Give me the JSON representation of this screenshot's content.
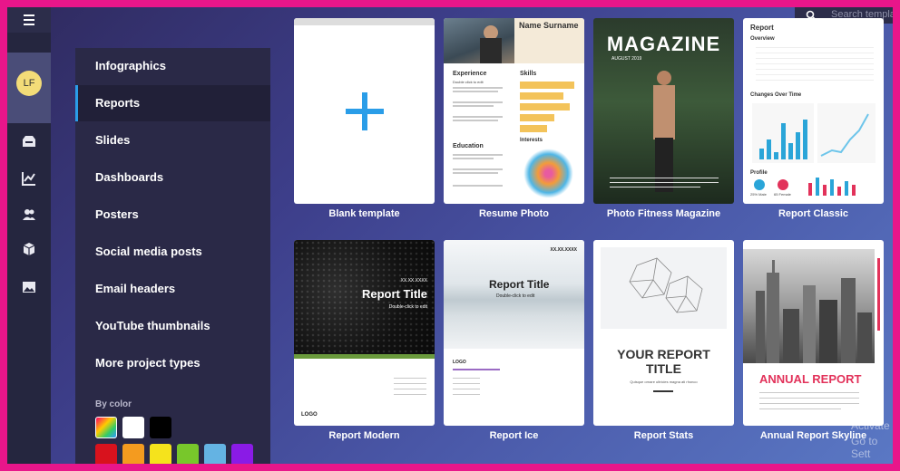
{
  "user": {
    "initials": "LF"
  },
  "rail": {
    "icons": [
      "menu-icon",
      "inbox-icon",
      "chart-icon",
      "users-icon",
      "cube-icon",
      "image-icon"
    ]
  },
  "categories": [
    {
      "label": "Infographics",
      "active": false
    },
    {
      "label": "Reports",
      "active": true
    },
    {
      "label": "Slides",
      "active": false
    },
    {
      "label": "Dashboards",
      "active": false
    },
    {
      "label": "Posters",
      "active": false
    },
    {
      "label": "Social media posts",
      "active": false
    },
    {
      "label": "Email headers",
      "active": false
    },
    {
      "label": "YouTube thumbnails",
      "active": false
    },
    {
      "label": "More project types",
      "active": false
    }
  ],
  "by_color": {
    "label": "By color",
    "swatches": [
      "#multicolor",
      "#ffffff",
      "#000000",
      "#d8121d",
      "#f49b1f",
      "#f5e31c",
      "#78c72b",
      "#64b3e3",
      "#8a1be6"
    ]
  },
  "search": {
    "placeholder": "Search templa"
  },
  "templates": [
    {
      "name": "Blank template"
    },
    {
      "name": "Resume Photo",
      "header": "Name Surname",
      "sections": [
        "Experience",
        "Skills",
        "Education",
        "Interests"
      ],
      "placeholder": "Double click to edit"
    },
    {
      "name": "Photo Fitness Magazine",
      "headline": "MAGAZINE",
      "date": "AUGUST 2019"
    },
    {
      "name": "Report Classic",
      "title": "Report",
      "sections": [
        "Overview",
        "Changes Over Time",
        "Profile"
      ],
      "stats": [
        "25% Male",
        "65 Female"
      ]
    },
    {
      "name": "Report Modern",
      "date": "XX.XX.XXXX",
      "title": "Report Title",
      "subtitle": "Double-click to edit",
      "logo": "LOGO"
    },
    {
      "name": "Report Ice",
      "date": "XX.XX.XXXX",
      "title": "Report Title",
      "subtitle": "Double-click to edit",
      "logo": "LOGO"
    },
    {
      "name": "Report Stats",
      "title": "YOUR REPORT\nTITLE",
      "subtitle": "Quisque ornare ultricies magna ati rhonco"
    },
    {
      "name": "Annual Report Skyline",
      "title": "ANNUAL REPORT"
    }
  ],
  "watermark": {
    "line1": "Activate",
    "line2": "Go to Sett"
  },
  "colors": {
    "accent": "#2a9de8",
    "rail": "#25263f",
    "panel": "#2a2947",
    "frame": "#e8168a"
  }
}
